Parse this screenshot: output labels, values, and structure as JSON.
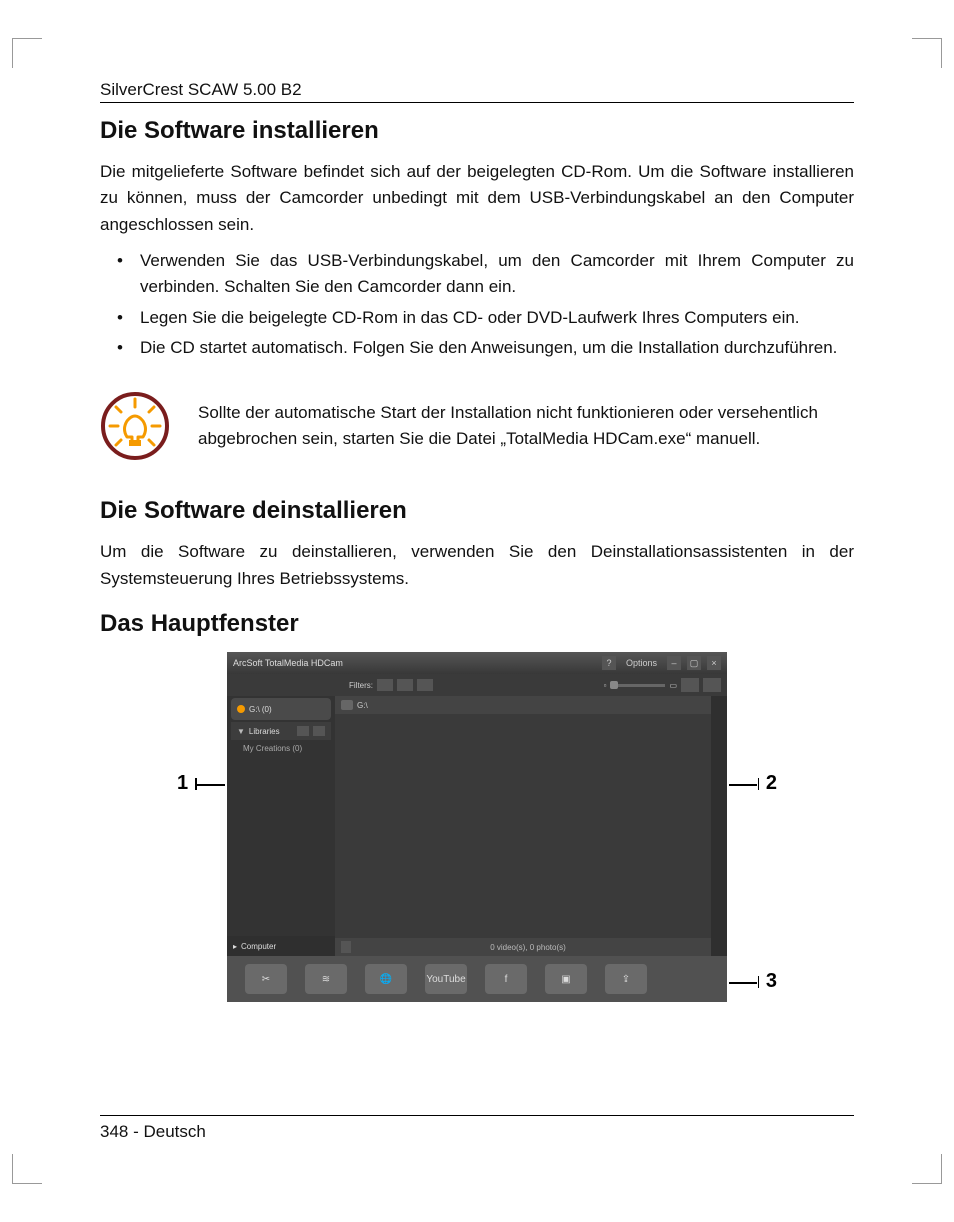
{
  "doc": {
    "header": "SilverCrest SCAW 5.00 B2",
    "footer": "348 - Deutsch"
  },
  "sections": {
    "install": {
      "title": "Die Software installieren",
      "paragraph": "Die mitgelieferte Software befindet sich auf der beigelegten CD-Rom. Um die Software installieren zu können, muss der Camcorder unbedingt mit dem USB-Verbindungskabel an den Computer angeschlossen sein.",
      "bullets": [
        "Verwenden Sie das USB-Verbindungskabel, um den Camcorder mit Ihrem Computer zu verbinden. Schalten Sie den Camcorder dann ein.",
        "Legen Sie die beigelegte CD-Rom in das CD- oder DVD-Laufwerk Ihres Computers ein.",
        "Die CD startet automatisch. Folgen Sie den Anweisungen, um die Installation durchzuführen."
      ],
      "tip": "Sollte der automatische Start der Installation nicht funktionieren oder versehentlich abgebrochen sein, starten Sie die Datei „TotalMedia HDCam.exe“ manuell."
    },
    "uninstall": {
      "title": "Die Software deinstallieren",
      "paragraph": "Um die Software zu deinstallieren, verwenden Sie den Deinstallationsassistenten in der Systemsteuerung Ihres Betriebssystems."
    },
    "mainwindow": {
      "title": "Das Hauptfenster"
    }
  },
  "figure": {
    "callouts": [
      "1",
      "2",
      "3"
    ],
    "window": {
      "title": "ArcSoft TotalMedia HDCam",
      "options": "Options",
      "filters_label": "Filters:",
      "sidebar": {
        "device": "G:\\ (0)",
        "libraries": "Libraries",
        "my_creations": "My Creations (0)",
        "computer": "Computer"
      },
      "pathbar": "G:\\",
      "status": "0 video(s), 0 photo(s)",
      "bottombar": {
        "youtube": "YouTube"
      }
    }
  }
}
